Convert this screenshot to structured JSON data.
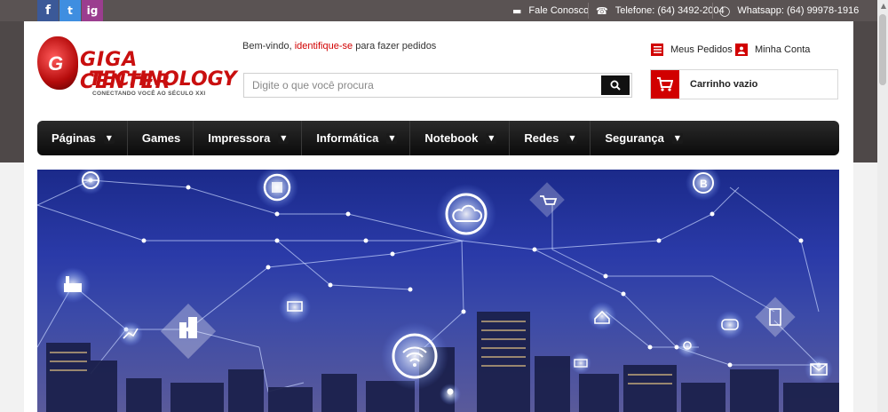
{
  "topbar": {
    "social": {
      "facebook": "f",
      "twitter": "t",
      "instagram": "ig"
    },
    "contact": {
      "label": "Fale Conosco"
    },
    "phone": {
      "label": "Telefone: (64) 3492-2004"
    },
    "whatsapp": {
      "label": "Whatsapp: (64) 99978-1916"
    }
  },
  "logo": {
    "line1": "GIGA CENTER",
    "line2": "TECHNOLOGY",
    "tagline": "CONECTANDO VOCÊ AO SÉCULO XXI"
  },
  "welcome": {
    "prefix": "Bem-vindo, ",
    "link": "identifique-se",
    "suffix": " para fazer pedidos"
  },
  "search": {
    "placeholder": "Digite o que você procura",
    "value": ""
  },
  "account": {
    "orders": "Meus Pedidos",
    "account": "Minha Conta"
  },
  "cart": {
    "label": "Carrinho vazio"
  },
  "nav": {
    "items": [
      {
        "label": "Páginas",
        "dropdown": true
      },
      {
        "label": "Games",
        "dropdown": false
      },
      {
        "label": "Impressora",
        "dropdown": true
      },
      {
        "label": "Informática",
        "dropdown": true
      },
      {
        "label": "Notebook",
        "dropdown": true
      },
      {
        "label": "Redes",
        "dropdown": true
      },
      {
        "label": "Segurança",
        "dropdown": true
      }
    ]
  },
  "colors": {
    "accent": "#d10000",
    "topbar": "#5a5353",
    "nav": "#111111"
  },
  "banner": {
    "icons": [
      "globe-icon",
      "brain-chip-icon",
      "cloud-icon",
      "cart-icon",
      "bitcoin-icon",
      "factory-icon",
      "buildings-icon",
      "laptop-icon",
      "home-icon",
      "chart-icon",
      "wifi-icon",
      "chat-icon",
      "tablet-icon",
      "location-icon",
      "mail-icon",
      "user-icon"
    ]
  }
}
